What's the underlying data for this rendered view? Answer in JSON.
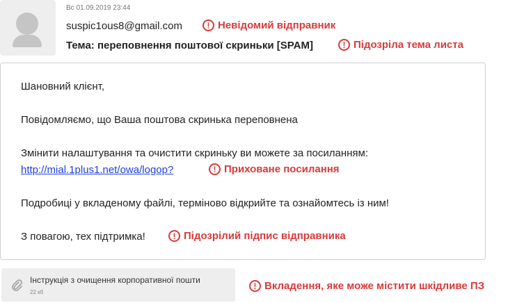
{
  "header": {
    "date": "Вс 01.09.2019 23:44",
    "sender": "suspic1ous8@gmail.com",
    "subject": "Тема: переповнення поштової скриньки [SPAM]"
  },
  "warnings": {
    "icon": "!",
    "sender": "Невідомий відправник",
    "subject": "Підозріла тема листа",
    "link": "Приховане посилання",
    "signature": "Підозрілий підпис відправника",
    "attachment": "Вкладення, яке може містити шкідливе ПЗ",
    "color": "#d83a3a"
  },
  "body": {
    "greeting": "Шановний клієнт,",
    "line1": "Повідомляємо, що Ваша поштова скринька переповнена",
    "line2": "Змінити налаштування та очистити скриньку ви можете за посиланням:",
    "link": "http://mial.1plus1.net/owa/logop?",
    "line3": "Подробиці у вкладеному файлі, терміново відкрийте та ознайомтесь із ним!",
    "signature": "З повагою, тех підтримка!"
  },
  "attachment": {
    "name": "Інструкція з очищення корпоративної пошти",
    "size": "22 кб",
    "icon": "paperclip-icon"
  },
  "colors": {
    "link": "#1d3fe0",
    "avatar_bg": "#eeeeee"
  }
}
